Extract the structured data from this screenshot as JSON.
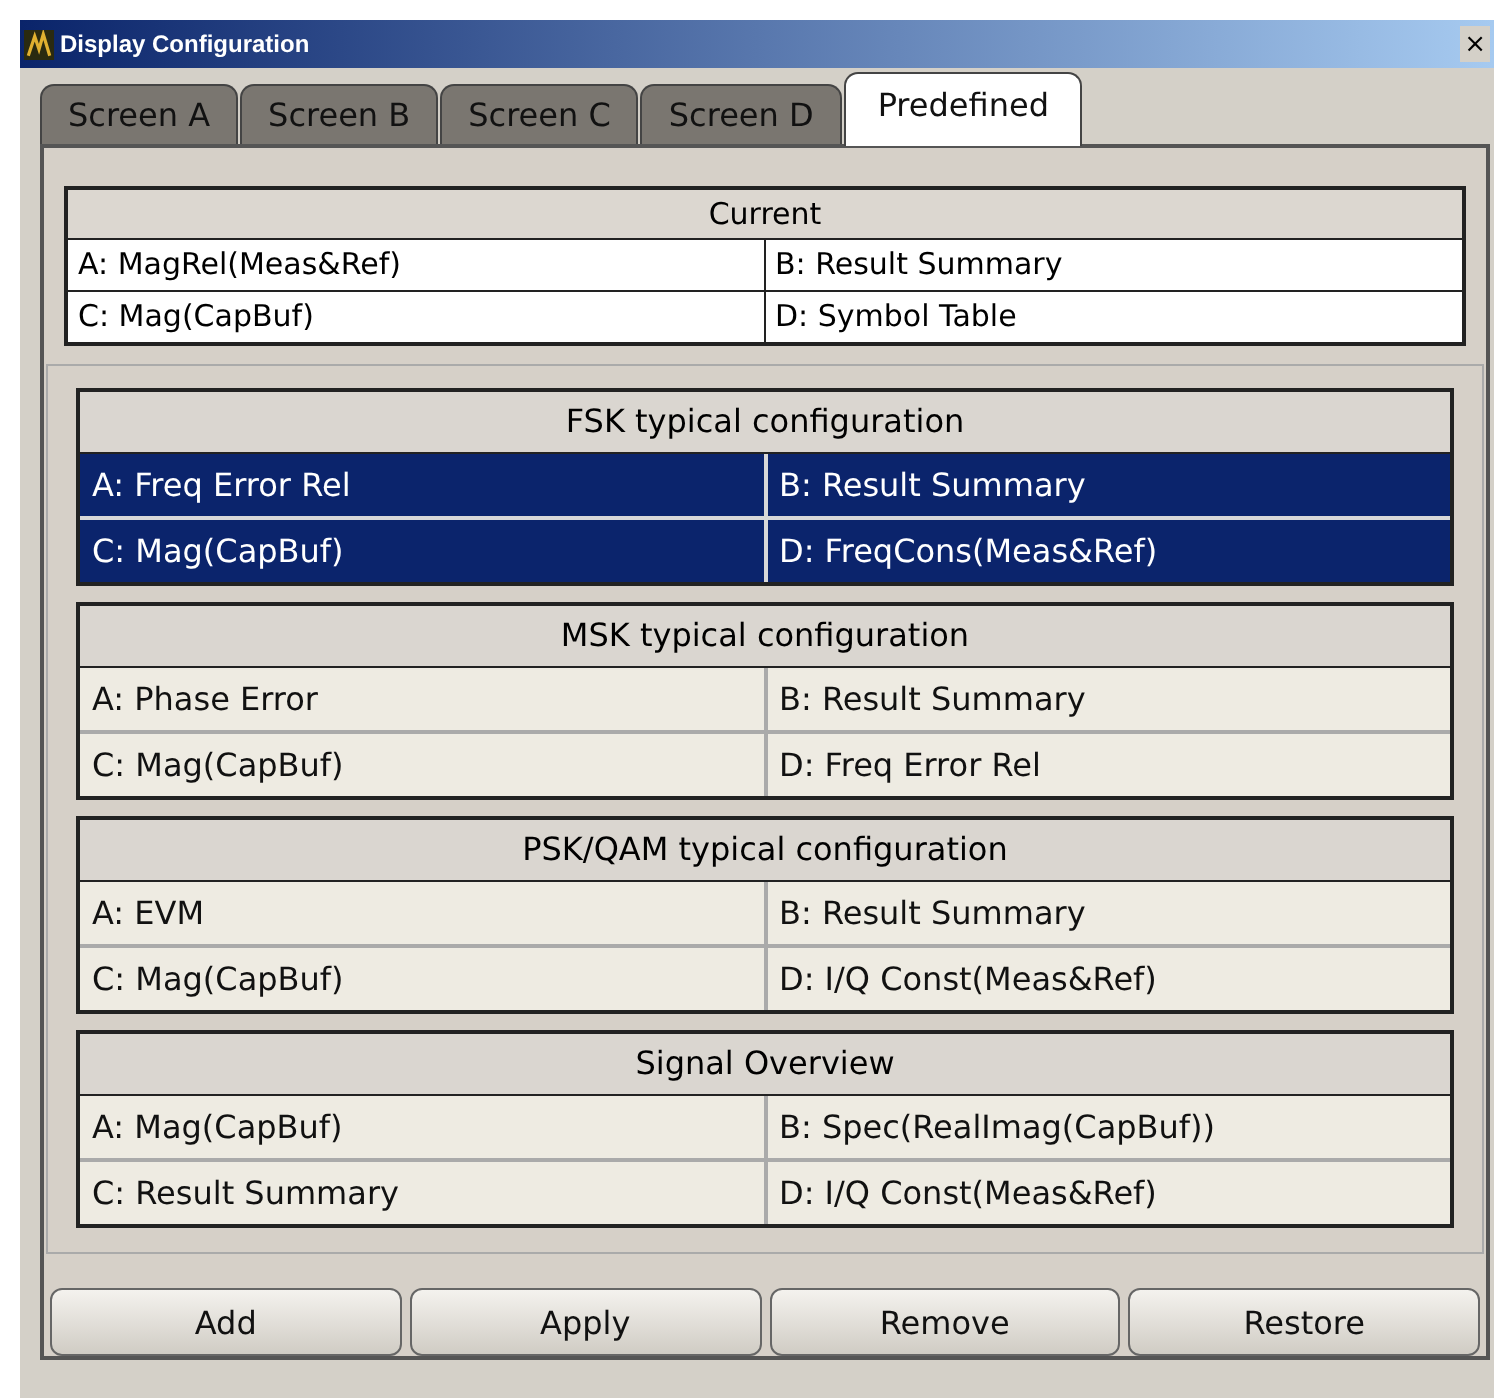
{
  "window": {
    "title": "Display Configuration",
    "close": "×"
  },
  "tabs": [
    {
      "label": "Screen A",
      "selected": false
    },
    {
      "label": "Screen B",
      "selected": false
    },
    {
      "label": "Screen C",
      "selected": false
    },
    {
      "label": "Screen D",
      "selected": false
    },
    {
      "label": "Predefined",
      "selected": true
    }
  ],
  "current": {
    "title": "Current",
    "cells": [
      "A: MagRel(Meas&Ref)",
      "B: Result Summary",
      "C: Mag(CapBuf)",
      "D: Symbol Table"
    ]
  },
  "configurations": [
    {
      "title": "FSK typical configuration",
      "selected": true,
      "cells": [
        "A: Freq Error Rel",
        "B: Result Summary",
        "C: Mag(CapBuf)",
        "D: FreqCons(Meas&Ref)"
      ]
    },
    {
      "title": "MSK typical configuration",
      "selected": false,
      "cells": [
        "A: Phase Error",
        "B: Result Summary",
        "C: Mag(CapBuf)",
        "D: Freq Error Rel"
      ]
    },
    {
      "title": "PSK/QAM typical configuration",
      "selected": false,
      "cells": [
        "A: EVM",
        "B: Result Summary",
        "C: Mag(CapBuf)",
        "D: I/Q Const(Meas&Ref)"
      ]
    },
    {
      "title": "Signal Overview",
      "selected": false,
      "cells": [
        "A: Mag(CapBuf)",
        "B: Spec(RealImag(CapBuf))",
        "C: Result Summary",
        "D: I/Q Const(Meas&Ref)"
      ]
    }
  ],
  "buttons": [
    "Add",
    "Apply",
    "Remove",
    "Restore"
  ]
}
